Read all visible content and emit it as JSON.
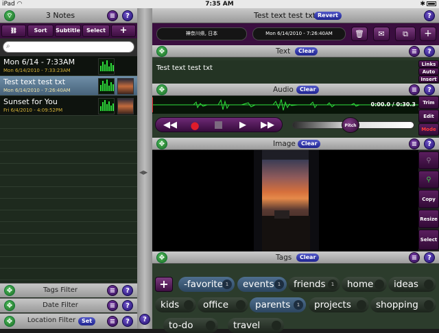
{
  "status_bar": {
    "device": "iPad",
    "time": "7:35 AM"
  },
  "notes_panel": {
    "title": "3 Notes",
    "toolbar": {
      "sort": "Sort",
      "subtitle": "Subtitle",
      "select": "Select",
      "add": "+"
    },
    "notes": [
      {
        "title": "Mon 6/14 - 7:33AM",
        "date": "Mon 6/14/2010 - 7:33:23AM"
      },
      {
        "title": "Test text test txt",
        "date": "Mon 6/14/2010 - 7:26:40AM"
      },
      {
        "title": "Sunset for You",
        "date": "Fri 6/4/2010 - 4:09:52PM"
      }
    ],
    "filters": {
      "tags": "Tags Filter",
      "date": "Date Filter",
      "location": "Location Filter",
      "set": "Set"
    }
  },
  "detail": {
    "title": "Test text test txt",
    "revert": "Revert",
    "location": "神奈川県, 日本",
    "date": "Mon 6/14/2010 - 7:26:40AM",
    "add": "+",
    "text_section": {
      "label": "Text",
      "clear": "Clear",
      "content": "Test text test txt",
      "side": {
        "links": "Links",
        "auto": "Auto",
        "insert": "Insert"
      }
    },
    "audio_section": {
      "label": "Audio",
      "clear": "Clear",
      "time": "0:00.0 / 0:30.3",
      "side": {
        "trim": "Trim",
        "edit": "Edit",
        "mode": "Mode"
      },
      "pitch": "Pitch"
    },
    "image_section": {
      "label": "Image",
      "clear": "Clear",
      "side": {
        "copy": "Copy",
        "resize": "Resize",
        "select": "Select"
      }
    },
    "tags_section": {
      "label": "Tags",
      "clear": "Clear",
      "add": "+",
      "tags": [
        {
          "name": "-favorite",
          "count": "1",
          "on": true
        },
        {
          "name": "events",
          "count": "1",
          "on": true
        },
        {
          "name": "friends",
          "count": "1",
          "on": false
        },
        {
          "name": "home",
          "count": "",
          "on": false
        },
        {
          "name": "ideas",
          "count": "",
          "on": false
        },
        {
          "name": "kids",
          "count": "",
          "on": false
        },
        {
          "name": "office",
          "count": "",
          "on": false
        },
        {
          "name": "parents",
          "count": "1",
          "on": true
        },
        {
          "name": "projects",
          "count": "",
          "on": false
        },
        {
          "name": "shopping",
          "count": "",
          "on": false
        },
        {
          "name": "to-do",
          "count": "",
          "on": false
        },
        {
          "name": "travel",
          "count": "",
          "on": false
        }
      ]
    }
  },
  "colors": {
    "header_gray": "#b5b5b5",
    "purple": "#3a0e3f",
    "green_bg": "#2a3a2a",
    "accent_blue": "#2f35a8",
    "waveform": "#2fe03c"
  }
}
